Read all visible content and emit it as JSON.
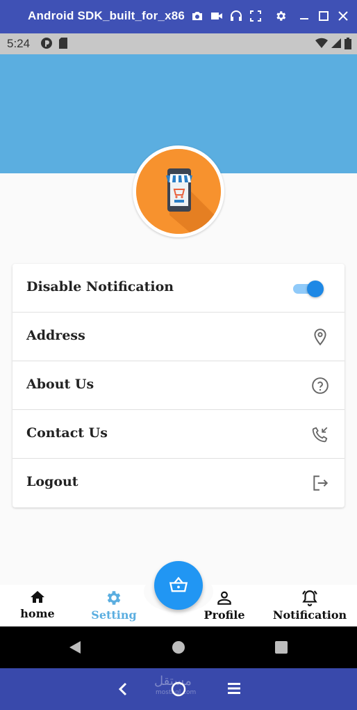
{
  "emulator": {
    "title": "Android SDK_built_for_x86",
    "icons": [
      "camera-icon",
      "video-icon",
      "headphones-icon",
      "fullscreen-icon",
      "gear-icon",
      "minimize-icon",
      "maximize-icon",
      "close-icon"
    ]
  },
  "status_bar": {
    "time": "5:24",
    "icons": [
      "app-badge-icon",
      "sd-card-icon",
      "wifi-icon",
      "signal-icon",
      "battery-icon"
    ]
  },
  "colors": {
    "header": "#5baee0",
    "accent": "#2196f3",
    "active_tab": "#5baee0",
    "logo_bg": "#f7922e"
  },
  "settings": {
    "items": [
      {
        "label": "Disable Notification",
        "control": "toggle",
        "toggle_on": true
      },
      {
        "label": "Address",
        "icon": "location-pin-icon"
      },
      {
        "label": "About Us",
        "icon": "help-circle-icon"
      },
      {
        "label": "Contact Us",
        "icon": "phone-callback-icon"
      },
      {
        "label": "Logout",
        "icon": "logout-icon"
      }
    ]
  },
  "bottom_nav": {
    "items": [
      {
        "label": "home",
        "icon": "home-icon",
        "active": false
      },
      {
        "label": "Setting",
        "icon": "gear-icon",
        "active": true
      },
      {
        "label": "Profile",
        "icon": "person-icon",
        "active": false
      },
      {
        "label": "Notification",
        "icon": "bell-icon",
        "active": false
      }
    ],
    "fab_icon": "basket-icon"
  },
  "system_nav": {
    "icons": [
      "back-icon",
      "home-circle-icon",
      "recents-icon"
    ]
  },
  "emulator_bottom": {
    "icons": [
      "chevron-left-icon",
      "circle-icon",
      "menu-icon"
    ],
    "watermark": "مستقل",
    "watermark_sub": "mostaql.com"
  }
}
